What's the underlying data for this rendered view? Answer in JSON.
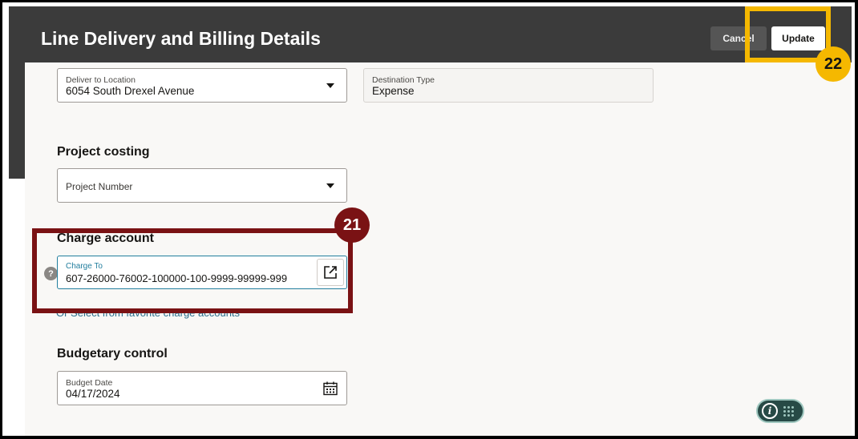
{
  "header": {
    "title": "Line Delivery and Billing Details",
    "cancel_label": "Cancel",
    "update_label": "Update"
  },
  "delivery": {
    "deliver_to_label": "Deliver to Location",
    "deliver_to_value": "6054 South Drexel Avenue",
    "destination_type_label": "Destination Type",
    "destination_type_value": "Expense"
  },
  "project_costing": {
    "title": "Project costing",
    "project_number_placeholder": "Project Number"
  },
  "charge_account": {
    "title": "Charge account",
    "charge_to_label": "Charge To",
    "charge_to_value": "607-26000-76002-100000-100-9999-99999-999",
    "favorites_link": "Or Select from favorite charge accounts",
    "help_glyph": "?"
  },
  "budgetary_control": {
    "title": "Budgetary control",
    "budget_date_label": "Budget Date",
    "budget_date_value": "04/17/2024"
  },
  "callouts": {
    "step_21": "21",
    "step_22": "22",
    "red_color": "#7a1214",
    "yellow_color": "#f5b800"
  },
  "info_button": {
    "glyph": "i"
  }
}
